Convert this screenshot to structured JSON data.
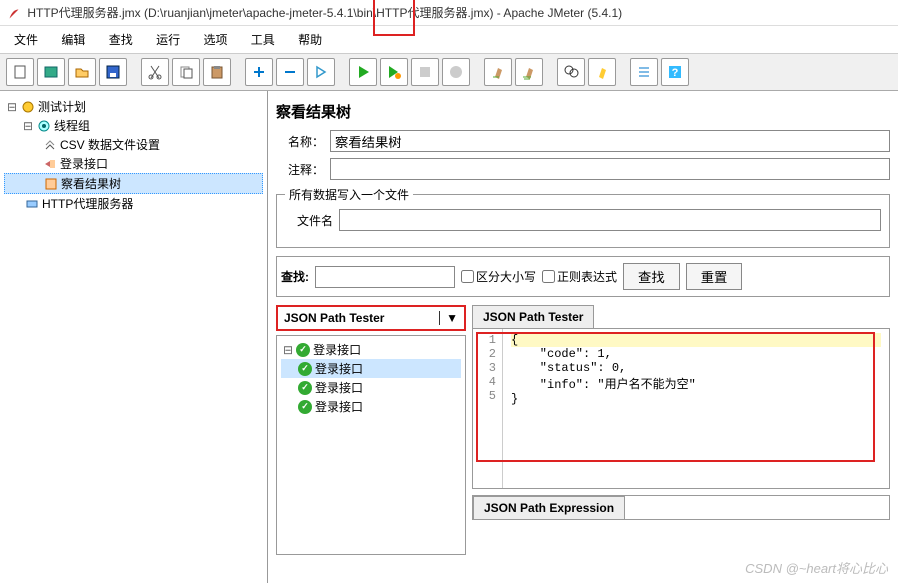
{
  "window": {
    "title": "HTTP代理服务器.jmx (D:\\ruanjian\\jmeter\\apache-jmeter-5.4.1\\bin\\HTTP代理服务器.jmx) - Apache JMeter (5.4.1)"
  },
  "menu": {
    "file": "文件",
    "edit": "编辑",
    "search": "查找",
    "run": "运行",
    "options": "选项",
    "tools": "工具",
    "help": "帮助"
  },
  "tree": {
    "testplan": "测试计划",
    "threadgroup": "线程组",
    "csv": "CSV 数据文件设置",
    "login": "登录接口",
    "resulttree": "察看结果树",
    "proxy": "HTTP代理服务器"
  },
  "panel": {
    "title": "察看结果树",
    "name_label": "名称：",
    "name_value": "察看结果树",
    "comment_label": "注释：",
    "writefile_legend": "所有数据写入一个文件",
    "filename_label": "文件名"
  },
  "searchbar": {
    "label": "查找:",
    "case": "区分大小写",
    "regex": "正则表达式",
    "find": "查找",
    "reset": "重置"
  },
  "dropdown": {
    "selected": "JSON Path Tester"
  },
  "results": {
    "login1": "登录接口",
    "login2": "登录接口",
    "login3": "登录接口",
    "login4": "登录接口"
  },
  "detail_tab": "JSON Path Tester",
  "json": {
    "l1": "{",
    "l2": "    \"code\": 1,",
    "l3": "    \"status\": 0,",
    "l4": "    \"info\": \"用户名不能为空\"",
    "l5": "}"
  },
  "bottom": {
    "expr_tab": "JSON Path Expression"
  },
  "watermark": "CSDN @~heart将心比心"
}
